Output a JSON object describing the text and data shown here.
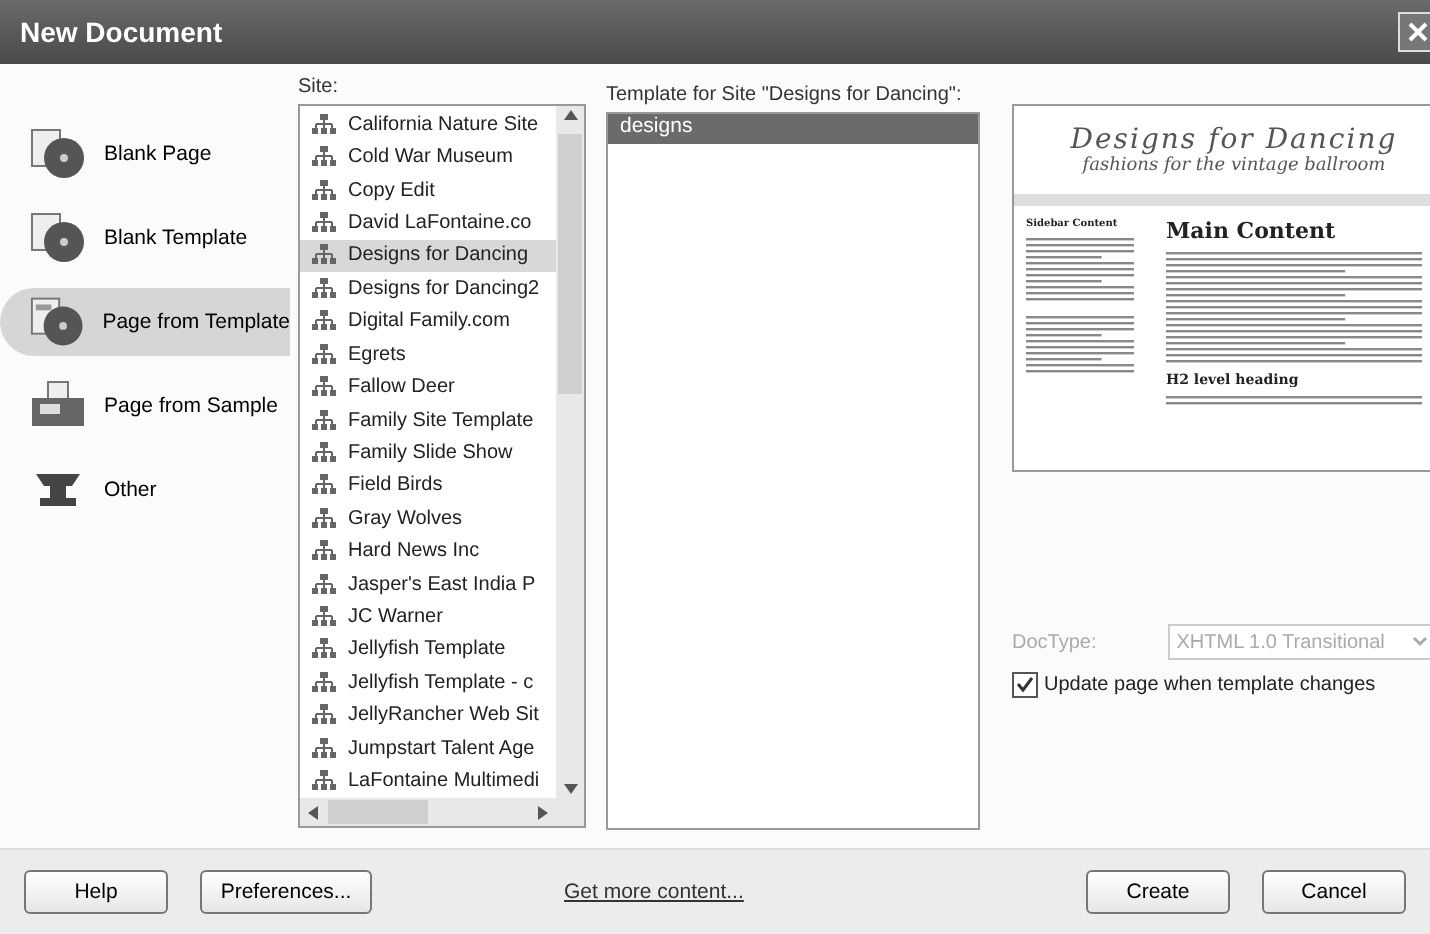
{
  "window": {
    "title": "New Document"
  },
  "categories": [
    {
      "label": "Blank Page",
      "kind": "page",
      "selected": false
    },
    {
      "label": "Blank Template",
      "kind": "page",
      "selected": false
    },
    {
      "label": "Page from Template",
      "kind": "template",
      "selected": true
    },
    {
      "label": "Page from Sample",
      "kind": "sample",
      "selected": false
    },
    {
      "label": "Other",
      "kind": "other",
      "selected": false
    }
  ],
  "site_list": {
    "label": "Site:",
    "items": [
      {
        "label": "California Nature Site",
        "selected": false
      },
      {
        "label": "Cold War Museum",
        "selected": false
      },
      {
        "label": "Copy Edit",
        "selected": false
      },
      {
        "label": "David LaFontaine.co",
        "selected": false
      },
      {
        "label": "Designs for Dancing",
        "selected": true
      },
      {
        "label": "Designs for Dancing2",
        "selected": false
      },
      {
        "label": "Digital Family.com",
        "selected": false
      },
      {
        "label": "Egrets",
        "selected": false
      },
      {
        "label": "Fallow Deer",
        "selected": false
      },
      {
        "label": "Family Site Template",
        "selected": false
      },
      {
        "label": "Family Slide Show",
        "selected": false
      },
      {
        "label": "Field Birds",
        "selected": false
      },
      {
        "label": "Gray Wolves",
        "selected": false
      },
      {
        "label": "Hard News Inc",
        "selected": false
      },
      {
        "label": "Jasper's East India P",
        "selected": false
      },
      {
        "label": "JC Warner",
        "selected": false
      },
      {
        "label": "Jellyfish Template",
        "selected": false
      },
      {
        "label": "Jellyfish Template - c",
        "selected": false
      },
      {
        "label": "JellyRancher Web Sit",
        "selected": false
      },
      {
        "label": "Jumpstart Talent Age",
        "selected": false
      },
      {
        "label": "LaFontaine Multimedi",
        "selected": false
      }
    ]
  },
  "template_list": {
    "label": "Template for Site \"Designs for Dancing\":",
    "items": [
      {
        "label": "designs",
        "selected": true
      }
    ]
  },
  "preview": {
    "title": "Designs for Dancing",
    "subtitle": "fashions for the vintage ballroom",
    "sidebar_heading": "Sidebar Content",
    "main_heading": "Main Content",
    "sub_heading": "H2 level heading"
  },
  "doctype": {
    "label": "DocType:",
    "value": "XHTML 1.0 Transitional",
    "disabled": true
  },
  "update_checkbox": {
    "label": "Update page when template changes",
    "checked": true
  },
  "footer": {
    "help": "Help",
    "preferences": "Preferences...",
    "link": "Get more content...",
    "create": "Create",
    "cancel": "Cancel"
  }
}
